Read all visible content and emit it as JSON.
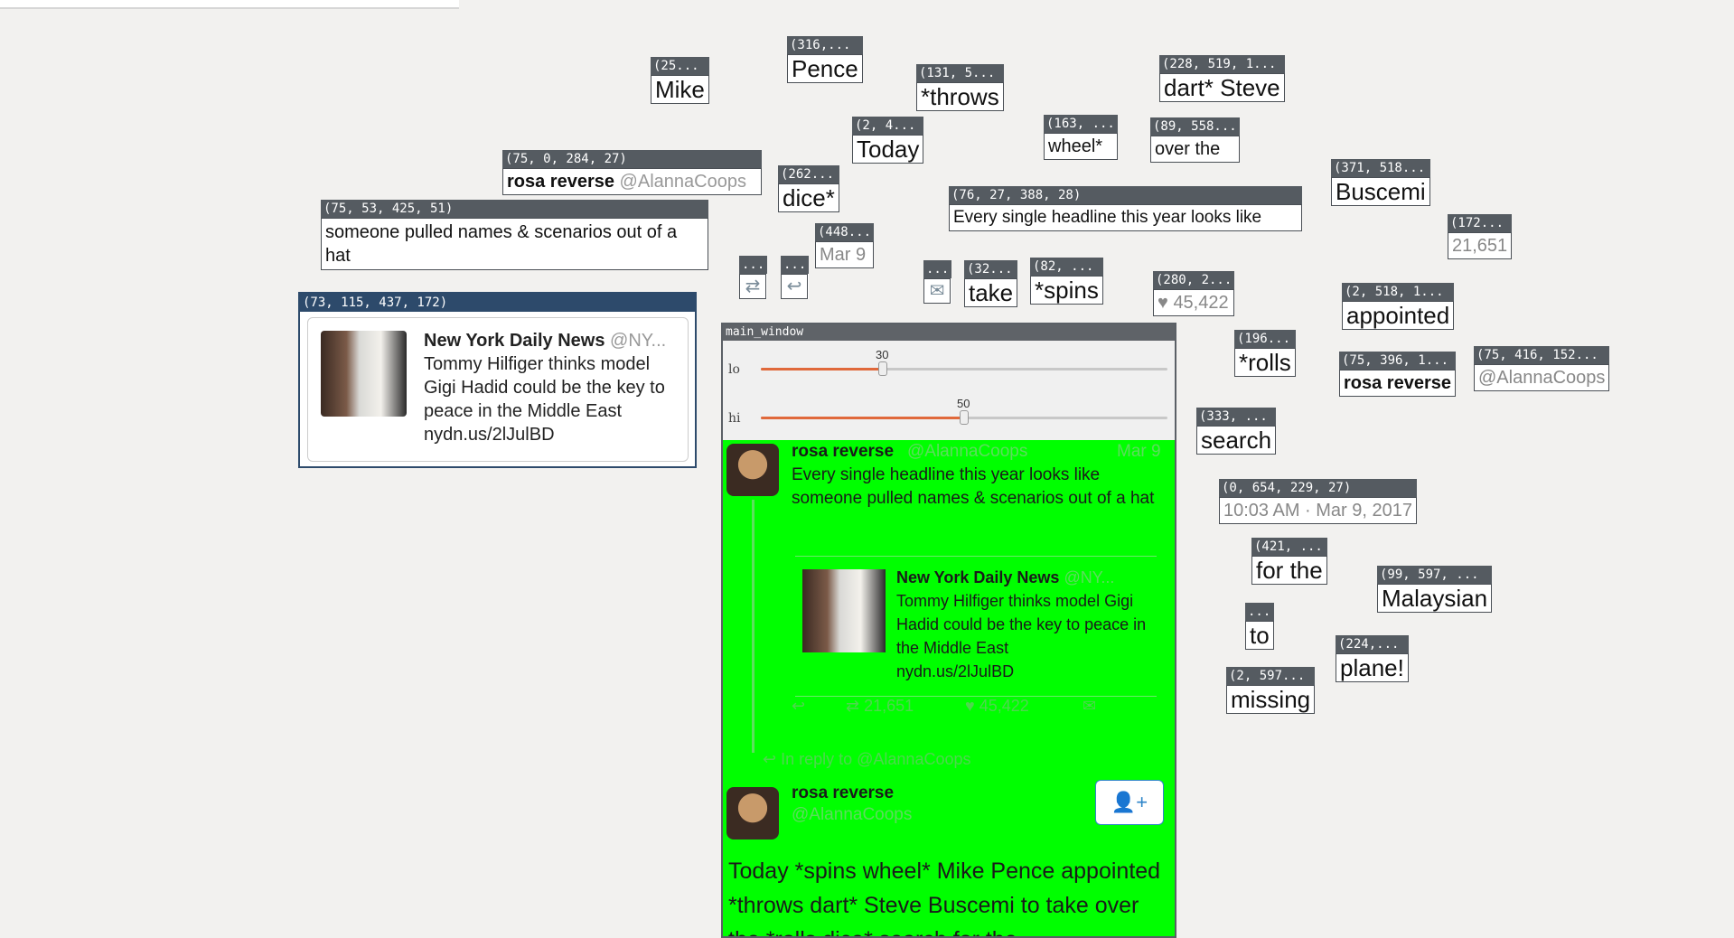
{
  "crops": {
    "mike": {
      "tag": "(25...",
      "text": "Mike"
    },
    "pence": {
      "tag": "(316,...",
      "text": "Pence"
    },
    "throws": {
      "tag": "(131, 5...",
      "text": "*throws"
    },
    "dart_steve": {
      "tag": "(228, 519, 1...",
      "text": "dart* Steve"
    },
    "today": {
      "tag": "(2, 4...",
      "text": "Today"
    },
    "wheel": {
      "tag": "(163, ...",
      "text": "wheel*"
    },
    "over_the": {
      "tag": "(89, 558...",
      "text": "over the"
    },
    "rosa_header": {
      "tag": "(75, 0, 284, 27)",
      "name": "rosa reverse",
      "handle": "@AlannaCoops"
    },
    "dice": {
      "tag": "(262...",
      "text": "dice*"
    },
    "every_single": {
      "tag": "(76, 27, 388, 28)",
      "text": "Every single headline this year looks like"
    },
    "buscemi": {
      "tag": "(371, 518...",
      "text": "Buscemi"
    },
    "someone": {
      "tag": "(75, 53, 425, 51)",
      "text": "someone pulled names & scenarios out of a hat"
    },
    "mar9": {
      "tag": "(448...",
      "text": "Mar 9"
    },
    "count_21651": {
      "tag": "(172...",
      "text": "21,651"
    },
    "retweet_icon": {
      "tag": "..."
    },
    "reply_icon": {
      "tag": "..."
    },
    "dm_icon": {
      "tag": "..."
    },
    "take": {
      "tag": "(32...",
      "text": "take"
    },
    "spins": {
      "tag": "(82, ...",
      "text": "*spins"
    },
    "likes": {
      "tag": "(280, 2...",
      "text": "45,422"
    },
    "appointed": {
      "tag": "(2, 518, 1...",
      "text": "appointed"
    },
    "rolls": {
      "tag": "(196...",
      "text": "*rolls"
    },
    "rosa_bold": {
      "tag": "(75, 396, 1...",
      "text": "rosa reverse"
    },
    "alanna_gray": {
      "tag": "(75, 416, 152...",
      "text": "@AlannaCoops"
    },
    "search": {
      "tag": "(333, ...",
      "text": "search"
    },
    "timestamp": {
      "tag": "(0, 654, 229, 27)",
      "text": "10:03 AM · Mar 9, 2017"
    },
    "for_the": {
      "tag": "(421, ...",
      "text": "for the"
    },
    "malaysian": {
      "tag": "(99, 597, ...",
      "text": "Malaysian"
    },
    "to": {
      "tag": "...",
      "text": "to"
    },
    "plane": {
      "tag": "(224,...",
      "text": "plane!"
    },
    "missing": {
      "tag": "(2, 597...",
      "text": "missing"
    }
  },
  "card_crop": {
    "tag": "(73, 115, 437, 172)",
    "source_name": "New York Daily News",
    "source_handle": "@NY...",
    "headline": "Tommy Hilfiger thinks model Gigi Hadid could be the key to peace in the Middle East",
    "link": "nydn.us/2lJulBD"
  },
  "main_window": {
    "title": "main_window",
    "sliders": [
      {
        "label": "lo",
        "value": 30,
        "max": 100
      },
      {
        "label": "hi",
        "value": 50,
        "max": 100
      }
    ],
    "tweet": {
      "name": "rosa reverse",
      "handle": "@AlannaCoops",
      "date": "Mar 9",
      "text": "Every single headline this year looks like someone pulled names & scenarios out of a hat",
      "quote_name": "New York Daily News",
      "quote_handle": "@NY...",
      "quote_text": "Tommy Hilfiger thinks model Gigi Hadid could be the key to peace in the Middle East",
      "quote_link": "nydn.us/2lJulBD",
      "retweets": "21,651",
      "likes": "45,422",
      "reply_context": "In reply to @AlannaCoops"
    },
    "reply": {
      "name": "rosa reverse",
      "handle": "@AlannaCoops",
      "text": "Today *spins wheel* Mike Pence appointed *throws dart* Steve Buscemi to take over the *rolls dice* search for the"
    }
  }
}
